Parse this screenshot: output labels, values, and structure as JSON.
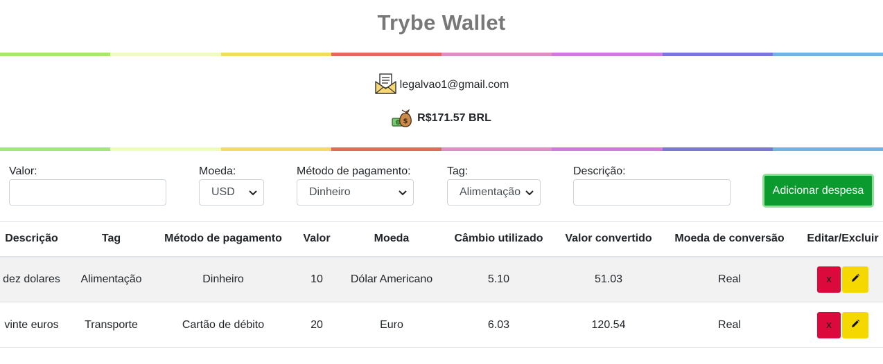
{
  "header": {
    "title": "Trybe Wallet"
  },
  "rainbow_colors": [
    "#a6e86d",
    "#eefcc2",
    "#f2dc5c",
    "#e8675d",
    "#db8fc3",
    "#cd7bdd",
    "#7b76dc",
    "#72b3e0"
  ],
  "user": {
    "email": "legalvao1@gmail.com",
    "email_icon": "envelope-letter-icon",
    "total": "R$171.57 BRL",
    "total_icon": "money-bag-icon"
  },
  "form": {
    "valor_label": "Valor:",
    "valor_value": "",
    "moeda_label": "Moeda:",
    "moeda_value": "USD",
    "metodo_label": "Método de pagamento:",
    "metodo_value": "Dinheiro",
    "tag_label": "Tag:",
    "tag_value": "Alimentação",
    "descricao_label": "Descrição:",
    "descricao_value": "",
    "add_button": "Adicionar despesa"
  },
  "table": {
    "headers": [
      "Descrição",
      "Tag",
      "Método de pagamento",
      "Valor",
      "Moeda",
      "Câmbio utilizado",
      "Valor convertido",
      "Moeda de conversão",
      "Editar/Excluir"
    ],
    "rows": [
      {
        "descricao": "dez dolares",
        "tag": "Alimentação",
        "metodo": "Dinheiro",
        "valor": "10",
        "moeda": "Dólar Americano",
        "cambio": "5.10",
        "convertido": "51.03",
        "conversao": "Real",
        "delete_label": "x"
      },
      {
        "descricao": "vinte euros",
        "tag": "Transporte",
        "metodo": "Cartão de débito",
        "valor": "20",
        "moeda": "Euro",
        "cambio": "6.03",
        "convertido": "120.54",
        "conversao": "Real",
        "delete_label": "x"
      }
    ]
  }
}
